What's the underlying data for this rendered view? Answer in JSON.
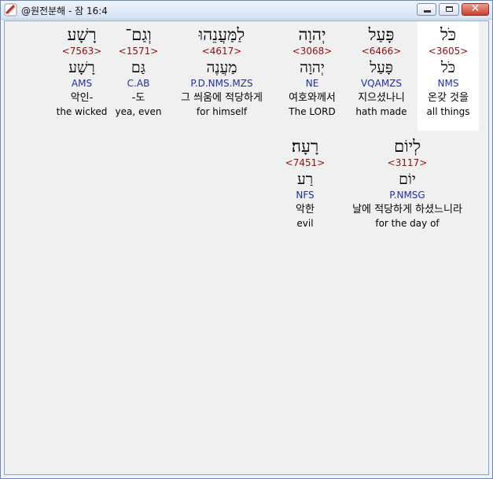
{
  "window": {
    "title": "@원전분해 - 잠 16:4",
    "buttons": {
      "minimize": "minimize-button",
      "maximize": "maximize-button",
      "close_symbol": "✕"
    }
  },
  "words": [
    {
      "hebrew": "כֹּל",
      "strong": "<3605>",
      "lemma": "כֹּל",
      "morph": "NMS",
      "korean": "온갖 것을",
      "english": "all things",
      "highlight": true
    },
    {
      "hebrew": "פָּעַל",
      "strong": "<6466>",
      "lemma": "פָּעַל",
      "morph": "VQAMZS",
      "korean": "지으셨나니",
      "english": "hath made",
      "highlight": false
    },
    {
      "hebrew": "יְהוָה",
      "strong": "<3068>",
      "lemma": "יְהוָה",
      "morph": "NE",
      "korean": "여호와께서",
      "english": "The LORD",
      "highlight": false
    },
    {
      "hebrew": "לַמַּעֲנֵהוּ",
      "strong": "<4617>",
      "lemma": "מַעֲנֶה",
      "morph": "P.D.NMS.MZS",
      "korean": "그 씌움에 적당하게",
      "english": "for himself",
      "highlight": false
    },
    {
      "hebrew": "וְגַם־",
      "strong": "<1571>",
      "lemma": "גַּם",
      "morph": "C.AB",
      "korean": "-도",
      "english": "yea, even",
      "highlight": false
    },
    {
      "hebrew": "רָשָׁע",
      "strong": "<7563>",
      "lemma": "רָשָׁע",
      "morph": "AMS",
      "korean": "악인-",
      "english": "the wicked",
      "highlight": false
    },
    {
      "hebrew": "לְיוֹם",
      "strong": "<3117>",
      "lemma": "יוֹם",
      "morph": "P.NMSG",
      "korean": "날에 적당하게 하셨느니라",
      "english": "for the day of",
      "highlight": false
    },
    {
      "hebrew": "רָעָה׃",
      "strong": "<7451>",
      "lemma": "רַע",
      "morph": "NFS",
      "korean": "악한",
      "english": "evil",
      "highlight": false
    }
  ],
  "colors": {
    "strong": "#8b1010",
    "morph": "#1e2fa8",
    "highlight_bg": "#ffffff",
    "background": "#f0f0f0"
  }
}
